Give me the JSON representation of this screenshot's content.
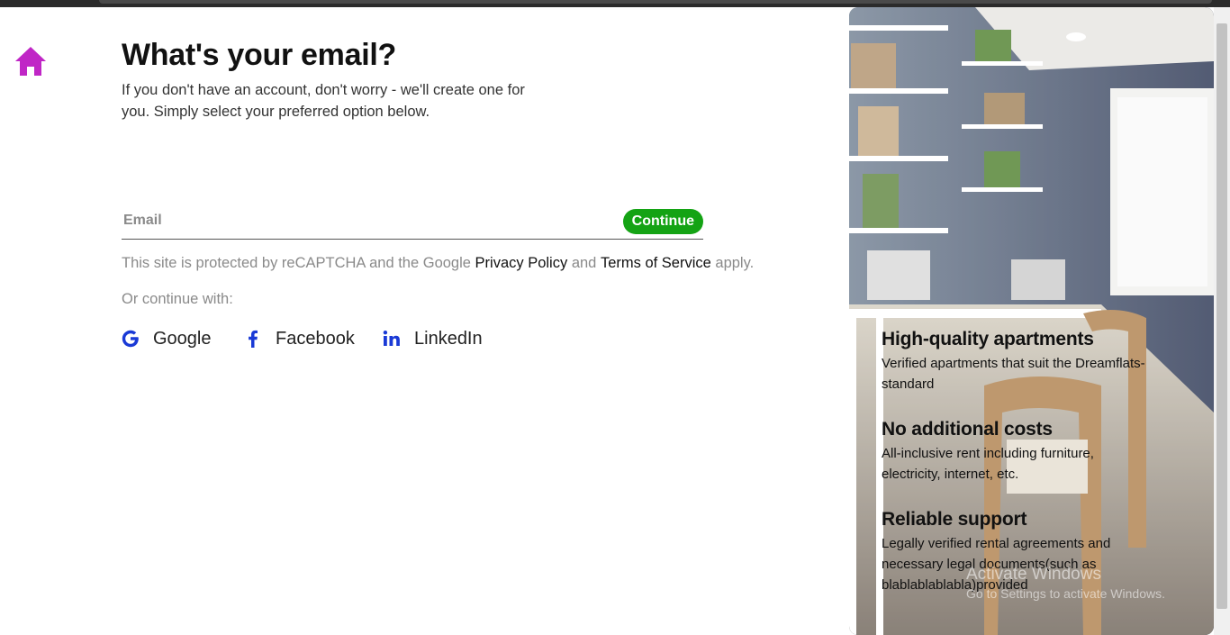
{
  "page": {
    "title": "What's your email?",
    "subtitle": "If you don't have an account, don't worry - we'll create one for you. Simply select your preferred option below."
  },
  "email": {
    "placeholder": "Email",
    "value": ""
  },
  "continue_label": "Continue",
  "recaptcha": {
    "prefix": "This site is protected by reCAPTCHA and the Google ",
    "privacy_label": "Privacy Policy",
    "and": " and ",
    "terms_label": "Terms of Service",
    "suffix": " apply."
  },
  "or_continue": "Or continue with:",
  "social": [
    {
      "label": "Google",
      "icon": "google-icon"
    },
    {
      "label": "Facebook",
      "icon": "facebook-icon"
    },
    {
      "label": "LinkedIn",
      "icon": "linkedin-icon"
    }
  ],
  "features": [
    {
      "title": "High-quality apartments",
      "text": "Verified apartments that suit the Dreamflats-standard"
    },
    {
      "title": "No additional costs",
      "text": "All-inclusive rent including furniture, electricity, internet, etc."
    },
    {
      "title": "Reliable support",
      "text": "Legally verified rental agreements and necessary legal documents(such as blablablablabla)provided"
    }
  ],
  "watermark": {
    "line1": "Activate Windows",
    "line2": "Go to Settings to activate Windows."
  },
  "colors": {
    "accent": "#c026c6",
    "continue": "#14a314",
    "social_icon": "#1a3ad6"
  }
}
